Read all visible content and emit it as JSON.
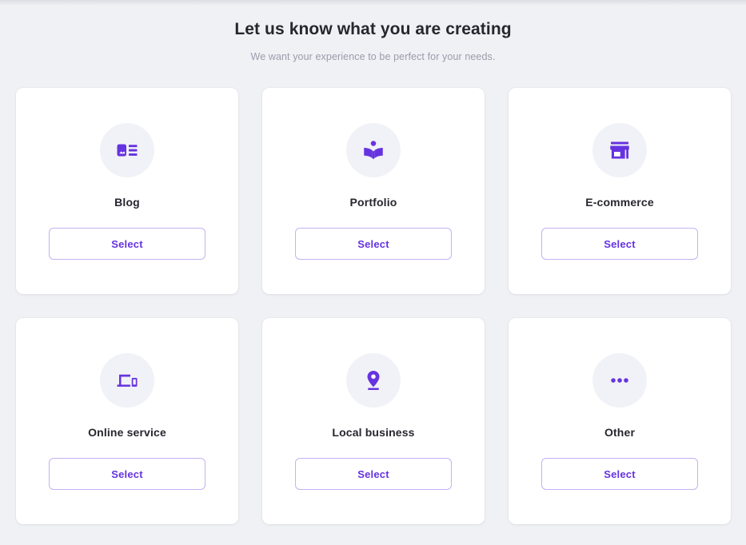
{
  "theme": {
    "page_background": "#f0f1f5",
    "card_background": "#ffffff",
    "icon_circle_background": "#f1f2f7",
    "accent": "#6633e0",
    "button_border": "#c4b2f4",
    "title_color": "#26262e",
    "subtitle_color": "#9b9bab"
  },
  "header": {
    "title": "Let us know what you are creating",
    "subtitle": "We want your experience to be perfect for your needs."
  },
  "cards": [
    {
      "label": "Blog",
      "icon": "article-image-icon",
      "select_label": "Select"
    },
    {
      "label": "Portfolio",
      "icon": "open-book-icon",
      "select_label": "Select"
    },
    {
      "label": "E-commerce",
      "icon": "storefront-icon",
      "select_label": "Select"
    },
    {
      "label": "Online service",
      "icon": "laptop-phone-devices-icon",
      "select_label": "Select"
    },
    {
      "label": "Local business",
      "icon": "map-pin-icon",
      "select_label": "Select"
    },
    {
      "label": "Other",
      "icon": "ellipsis-dots-icon",
      "select_label": "Select"
    }
  ]
}
